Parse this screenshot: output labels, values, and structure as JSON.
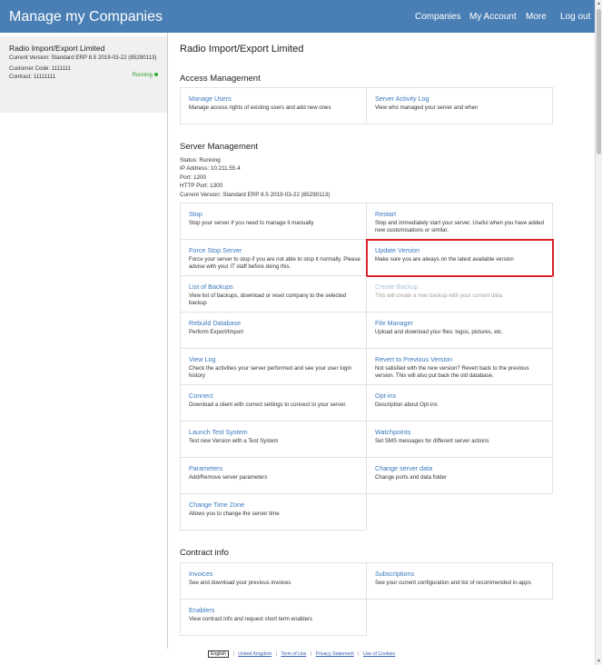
{
  "header": {
    "title": "Manage my Companies",
    "nav": [
      "Companies",
      "My Account",
      "More",
      "Log out"
    ]
  },
  "sidebar": {
    "company_name": "Radio Import/Export Limited",
    "current_version": "Current Version: Standard ERP 8.5 2019-03-22 (85290113)",
    "customer_code": "Customer Code: 1111111",
    "contract": "Contract: 11111111",
    "status": "Running"
  },
  "main": {
    "title": "Radio Import/Export Limited",
    "access": {
      "heading": "Access Management",
      "items": [
        {
          "title": "Manage Users",
          "desc": "Manage access rights of existing users and add new ones"
        },
        {
          "title": "Server Activity Log",
          "desc": "View who managed your server and when"
        }
      ]
    },
    "server": {
      "heading": "Server Management",
      "status_lines": [
        "Status: Running",
        "IP Address: 10.211.55.4",
        "Port: 1200",
        "HTTP Port: 1300",
        "Current Version: Standard ERP 8.5 2019-03-22 (85290113)"
      ],
      "items": [
        {
          "title": "Stop",
          "desc": "Stop your server if you need to manage it manually"
        },
        {
          "title": "Restart",
          "desc": "Stop and immediately start your server. Useful when you have added new customisations or similar."
        },
        {
          "title": "Force Stop Server",
          "desc": "Force your server to stop if you are not able to stop it normally. Please advise with your IT staff before doing this."
        },
        {
          "title": "Update Version",
          "desc": "Make sure you are always on the latest available version"
        },
        {
          "title": "List of Backups",
          "desc": "View list of backups, download or reset company to the selected backup"
        },
        {
          "title": "Create Backup",
          "desc": "This will create a new backup with your current data."
        },
        {
          "title": "Rebuild Database",
          "desc": "Perform Export/Import"
        },
        {
          "title": "File Manager",
          "desc": "Upload and download your files: logos, pictures, etc."
        },
        {
          "title": "View Log",
          "desc": "Check the activities your server performed and see your user login history"
        },
        {
          "title": "Revert to Previous Version",
          "desc": "Not satisfied with the new version? Revert back to the previous version. This will also put back the old database."
        },
        {
          "title": "Connect",
          "desc": "Download a client with correct settings to connect to your server."
        },
        {
          "title": "Opt-ins",
          "desc": "Description about Opt-ins"
        },
        {
          "title": "Launch Test System",
          "desc": "Test new Version with a Test System"
        },
        {
          "title": "Watchpoints",
          "desc": "Set SMS messages for different server actions"
        },
        {
          "title": "Parameters",
          "desc": "Add/Remove server parameters"
        },
        {
          "title": "Change server data",
          "desc": "Change ports and data folder"
        },
        {
          "title": "Change Time Zone",
          "desc": "Allows you to change the server time"
        }
      ]
    },
    "contract": {
      "heading": "Contract info",
      "items": [
        {
          "title": "Invoices",
          "desc": "See and download your previous invoices"
        },
        {
          "title": "Subscriptions",
          "desc": "See your current configuration and list of recommended in-apps"
        },
        {
          "title": "Enablers",
          "desc": "View contract info and request short term enablers"
        }
      ]
    }
  },
  "footer": {
    "language": "English",
    "links": [
      "United Kingdom",
      "Term of Use",
      "Privacy Statement",
      "Use of Cookies"
    ]
  },
  "colors": {
    "header_bg": "#4a7fb5",
    "link": "#3a79c0",
    "highlight": "#d9232a",
    "running": "#2f9e2f"
  }
}
